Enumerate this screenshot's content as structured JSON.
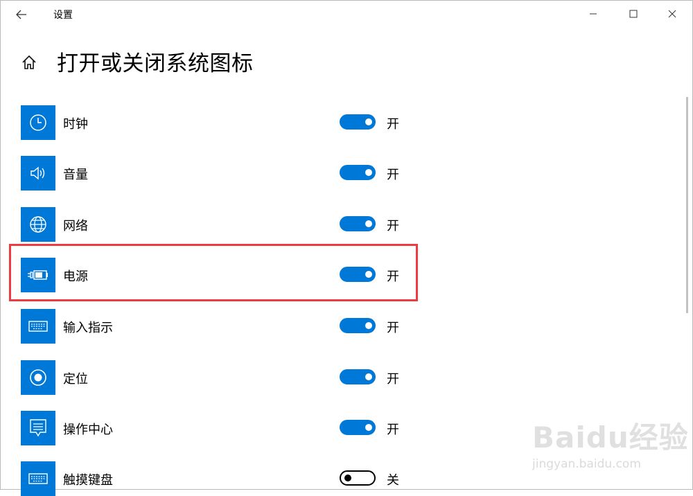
{
  "window": {
    "app_title": "设置",
    "controls": [
      "minimize-icon",
      "maximize-icon",
      "close-icon"
    ]
  },
  "header": {
    "title": "打开或关闭系统图标",
    "home_icon": "home-icon",
    "back_icon": "back-arrow-icon"
  },
  "colors": {
    "accent": "#0078d7",
    "highlight_border": "#ee3b3f",
    "background": "#ffffff"
  },
  "items": [
    {
      "label": "时钟",
      "icon": "clock-icon",
      "state": "开",
      "on": true
    },
    {
      "label": "音量",
      "icon": "volume-icon",
      "state": "开",
      "on": true
    },
    {
      "label": "网络",
      "icon": "globe-icon",
      "state": "开",
      "on": true
    },
    {
      "label": "电源",
      "icon": "battery-plug-icon",
      "state": "开",
      "on": true,
      "highlighted": true
    },
    {
      "label": "输入指示",
      "icon": "keyboard-icon",
      "state": "开",
      "on": true
    },
    {
      "label": "定位",
      "icon": "location-icon",
      "state": "开",
      "on": true
    },
    {
      "label": "操作中心",
      "icon": "action-center-icon",
      "state": "开",
      "on": true
    },
    {
      "label": "触摸键盘",
      "icon": "keyboard-icon",
      "state": "关",
      "on": false
    }
  ],
  "watermark": {
    "logo": "Baidu经验",
    "url": "jingyan.baidu.com"
  }
}
